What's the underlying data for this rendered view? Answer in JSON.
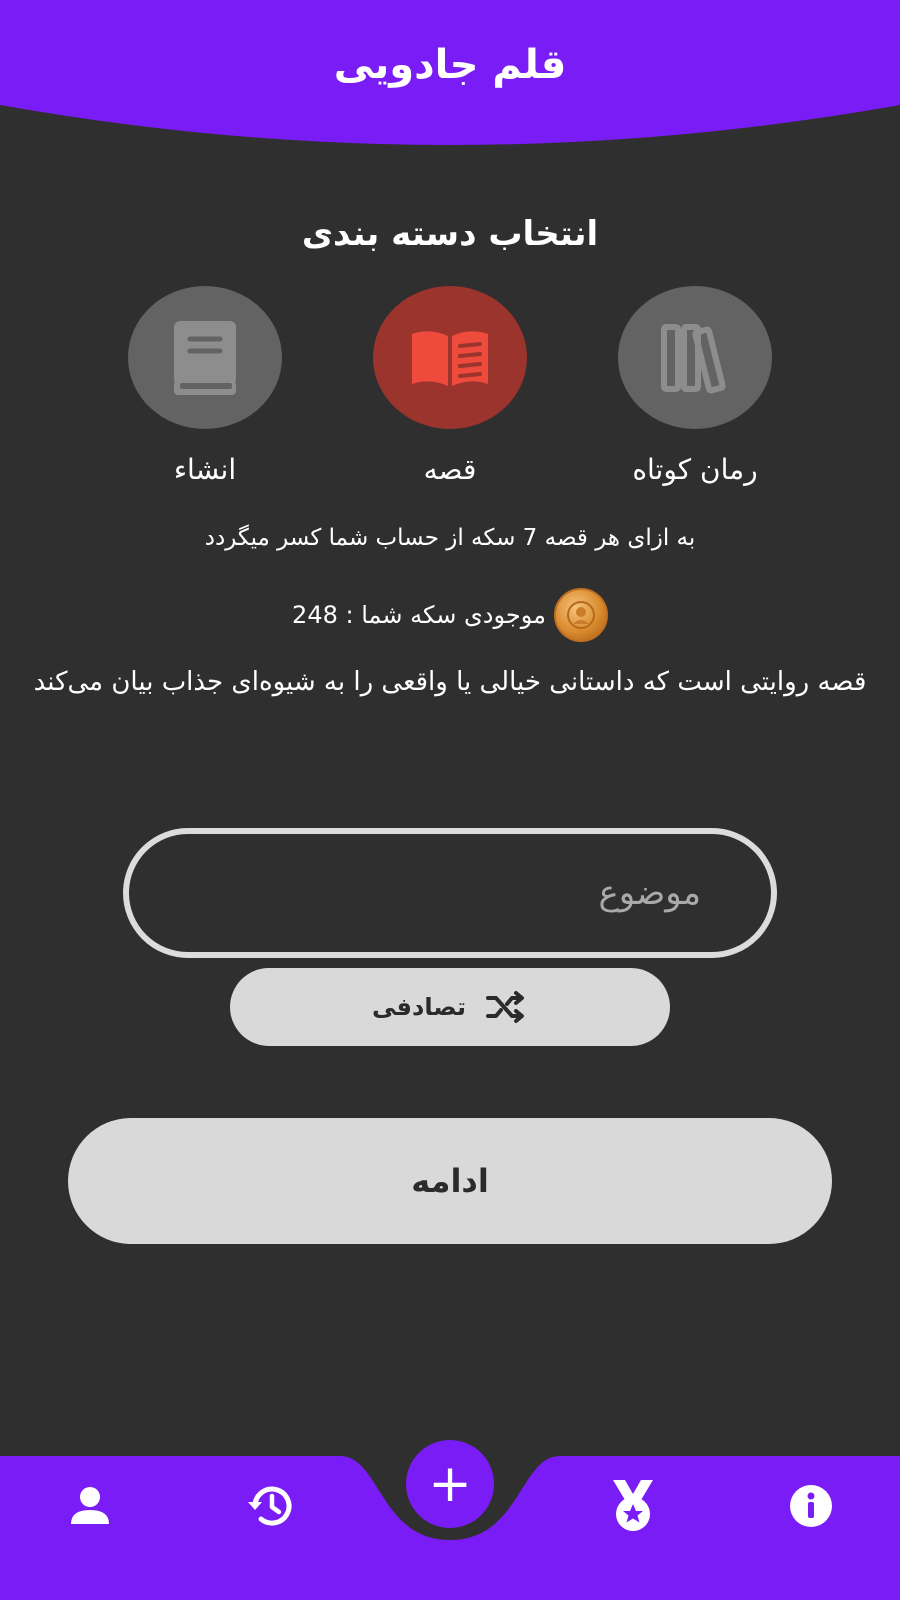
{
  "app": {
    "title": "قلم جادویی",
    "accent_color": "#7a1cf5",
    "background_color": "#2f2f2f"
  },
  "category_section": {
    "title": "انتخاب دسته بندی",
    "items": [
      {
        "label": "رمان کوتاه",
        "icon": "books-icon",
        "selected": false,
        "color": "#636363"
      },
      {
        "label": "قصه",
        "icon": "open-book-icon",
        "selected": true,
        "color": "#9b342c"
      },
      {
        "label": "انشاء",
        "icon": "notebook-icon",
        "selected": false,
        "color": "#636363"
      }
    ]
  },
  "cost_text": "به ازای هر قصه 7 سکه از حساب شما کسر میگردد",
  "balance": {
    "text": "موجودی سکه شما : 248",
    "icon": "coin-icon"
  },
  "description": "قصه روایتی است که داستانی خیالی یا واقعی را به شیوه‌ای جذاب بیان می‌کند",
  "topic_input": {
    "placeholder": "موضوع",
    "value": ""
  },
  "random_button": {
    "label": "تصادفی",
    "icon": "shuffle-icon"
  },
  "continue_button": {
    "label": "ادامه"
  },
  "bottom_nav": {
    "items": [
      {
        "name": "info",
        "icon": "info-icon"
      },
      {
        "name": "awards",
        "icon": "medal-icon"
      },
      {
        "name": "create",
        "icon": "plus-icon",
        "label": "+"
      },
      {
        "name": "history",
        "icon": "history-icon"
      },
      {
        "name": "profile",
        "icon": "user-icon"
      }
    ]
  }
}
